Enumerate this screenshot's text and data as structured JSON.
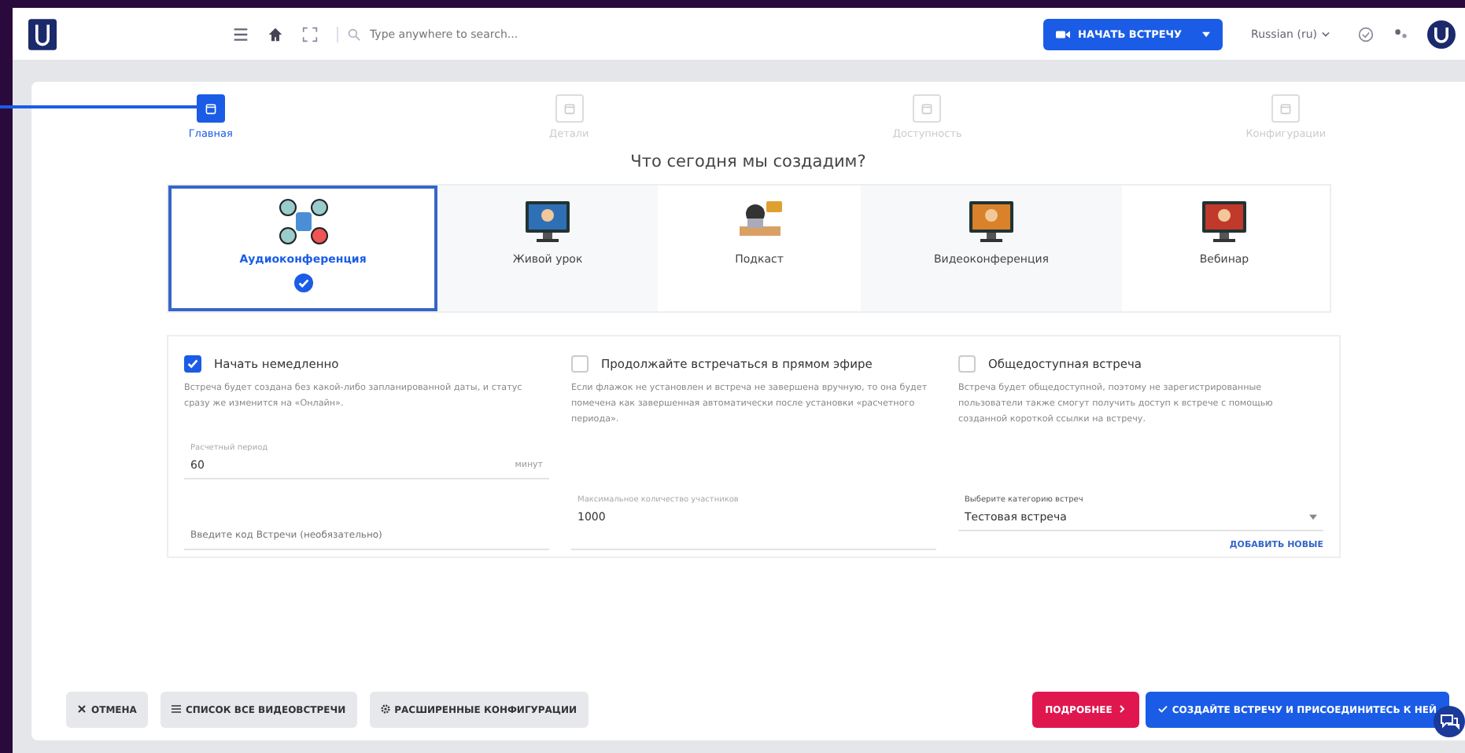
{
  "topbar": {
    "search": {
      "placeholder": "Type anywhere to search..."
    },
    "start_button": "НАЧАТЬ ВСТРЕЧУ",
    "language": "Russian (ru)"
  },
  "steps": [
    {
      "label": "Главная",
      "selected": true
    },
    {
      "label": "Детали",
      "selected": false
    },
    {
      "label": "Доступность",
      "selected": false
    },
    {
      "label": "Конфигурации",
      "selected": false
    }
  ],
  "heading": "Что сегодня мы создадим?",
  "meeting_types": [
    {
      "label": "Аудиоконференция",
      "kind": "audio",
      "selected": true
    },
    {
      "label": "Живой урок",
      "kind": "lesson",
      "selected": false
    },
    {
      "label": "Подкаст",
      "kind": "podcast",
      "selected": false
    },
    {
      "label": "Видеоконференция",
      "kind": "video",
      "selected": false
    },
    {
      "label": "Вебинар",
      "kind": "webinar",
      "selected": false
    }
  ],
  "options": [
    {
      "label": "Начать немедленно",
      "checked": true,
      "description": "Встреча будет создана без какой-либо запланированной даты, и статус сразу же изменится на «Онлайн»."
    },
    {
      "label": "Продолжайте встречаться в прямом эфире",
      "checked": false,
      "description": "Если флажок не установлен и встреча не завершена вручную, то она будет помечена как завершенная автоматически после установки «расчетного периода»."
    },
    {
      "label": "Общедоступная встреча",
      "checked": false,
      "description": "Встреча будет общедоступной, поэтому не зарегистрированные пользователи также смогут получить доступ к встрече с помощью созданной короткой ссылки на встречу."
    }
  ],
  "duration": {
    "label": "Расчетный период",
    "value": "60",
    "unit": "минут"
  },
  "code_field": {
    "placeholder": "Введите код Встречи (необязательно)"
  },
  "max_participants": {
    "label": "Максимальное количество участников",
    "value": "1000"
  },
  "category": {
    "label": "Выберите категорию встреч",
    "value": "Тестовая встреча",
    "add_link": "ДОБАВИТЬ НОВЫЕ"
  },
  "footer": {
    "cancel": "ОТМЕНА",
    "list": "СПИСОК ВСЕ ВИДЕОВСТРЕЧИ",
    "advanced": "РАСШИРЕННЫЕ КОНФИГУРАЦИИ",
    "more": "ПОДРОБНЕЕ",
    "create": "СОЗДАЙТЕ ВСТРЕЧУ И ПРИСОЕДИНИТЕСЬ К НЕЙ"
  }
}
